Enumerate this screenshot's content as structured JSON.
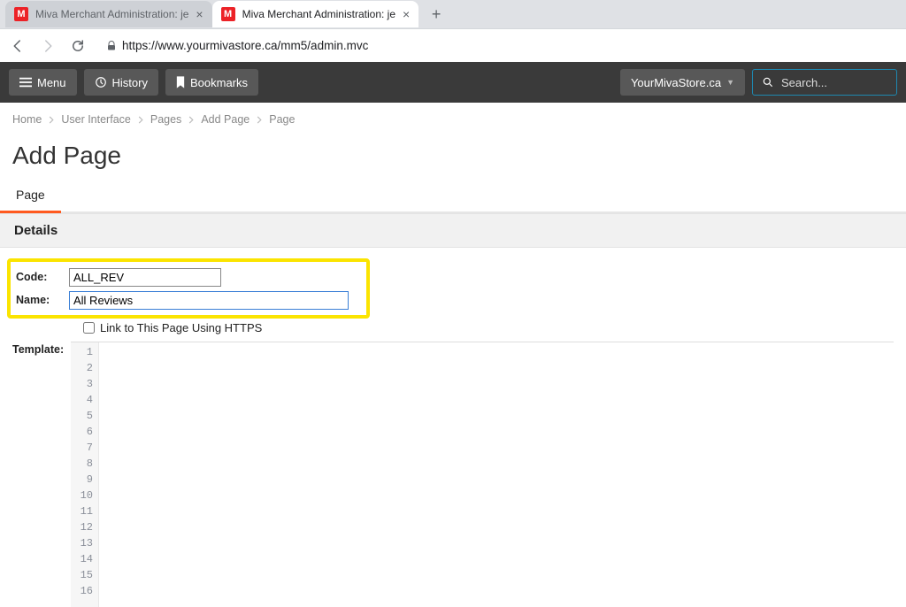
{
  "browser": {
    "tabs": [
      {
        "title": "Miva Merchant Administration: je",
        "favicon": "M",
        "active": false
      },
      {
        "title": "Miva Merchant Administration: je",
        "favicon": "M",
        "active": true
      }
    ],
    "url": "https://www.yourmivastore.ca/mm5/admin.mvc"
  },
  "topbar": {
    "menu": "Menu",
    "history": "History",
    "bookmarks": "Bookmarks",
    "store": "YourMivaStore.ca",
    "search_placeholder": "Search..."
  },
  "breadcrumb": [
    "Home",
    "User Interface",
    "Pages",
    "Add Page",
    "Page"
  ],
  "page": {
    "title": "Add Page",
    "tabs": [
      {
        "label": "Page",
        "active": true
      }
    ]
  },
  "section": {
    "details_header": "Details"
  },
  "form": {
    "code_label": "Code:",
    "code_value": "ALL_REV",
    "name_label": "Name:",
    "name_value": "All Reviews",
    "https_label": "Link to This Page Using HTTPS",
    "https_checked": false,
    "template_label": "Template:"
  },
  "editor": {
    "line_numbers": [
      "1",
      "2",
      "3",
      "4",
      "5",
      "6",
      "7",
      "8",
      "9",
      "10",
      "11",
      "12",
      "13",
      "14",
      "15",
      "16"
    ]
  }
}
